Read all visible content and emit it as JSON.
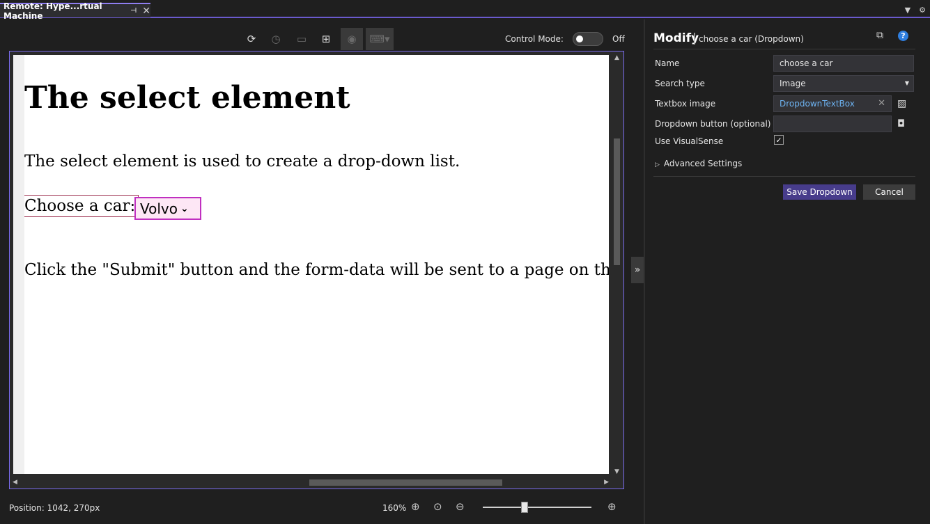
{
  "tab": {
    "title": "Remote: Hype...rtual Machine",
    "pin_glyph": "⊣",
    "close_glyph": "✕"
  },
  "strip": {
    "dropdown_glyph": "▼",
    "settings_glyph": "⚙"
  },
  "toolbar": {
    "icons": [
      "refresh-icon",
      "history-icon",
      "window-icon",
      "select-element-icon",
      "screenshot-icon",
      "keyboard-icon"
    ],
    "control_mode_label": "Control Mode:",
    "control_mode_state": "Off"
  },
  "page": {
    "heading": "The select element",
    "description": "The select element is used to create a drop-down list.",
    "label": "Choose a car:",
    "select_value": "Volvo",
    "submit_text": "Click the \"Submit\" button and the form-data will be sent to a page on the"
  },
  "status": {
    "position": "Position: 1042, 270px",
    "zoom": "160%",
    "zoom_slider_fraction": 0.38
  },
  "panel": {
    "title": "Modify",
    "separator": "|",
    "subtitle": "choose a car (Dropdown)",
    "fields": {
      "name_label": "Name",
      "name_value": "choose a car",
      "search_type_label": "Search type",
      "search_type_value": "Image",
      "textbox_image_label": "Textbox image",
      "textbox_image_value": "DropdownTextBox",
      "dropdown_button_label": "Dropdown button (optional)",
      "dropdown_button_value": "",
      "use_visualsense_label": "Use VisualSense",
      "use_visualsense_checked": true
    },
    "advanced_label": "Advanced Settings",
    "save_label": "Save Dropdown",
    "cancel_label": "Cancel"
  },
  "colors": {
    "accent": "#7b6cf0",
    "save_button": "#473c8b",
    "link": "#6db3f2",
    "select_border": "#c030c0"
  }
}
